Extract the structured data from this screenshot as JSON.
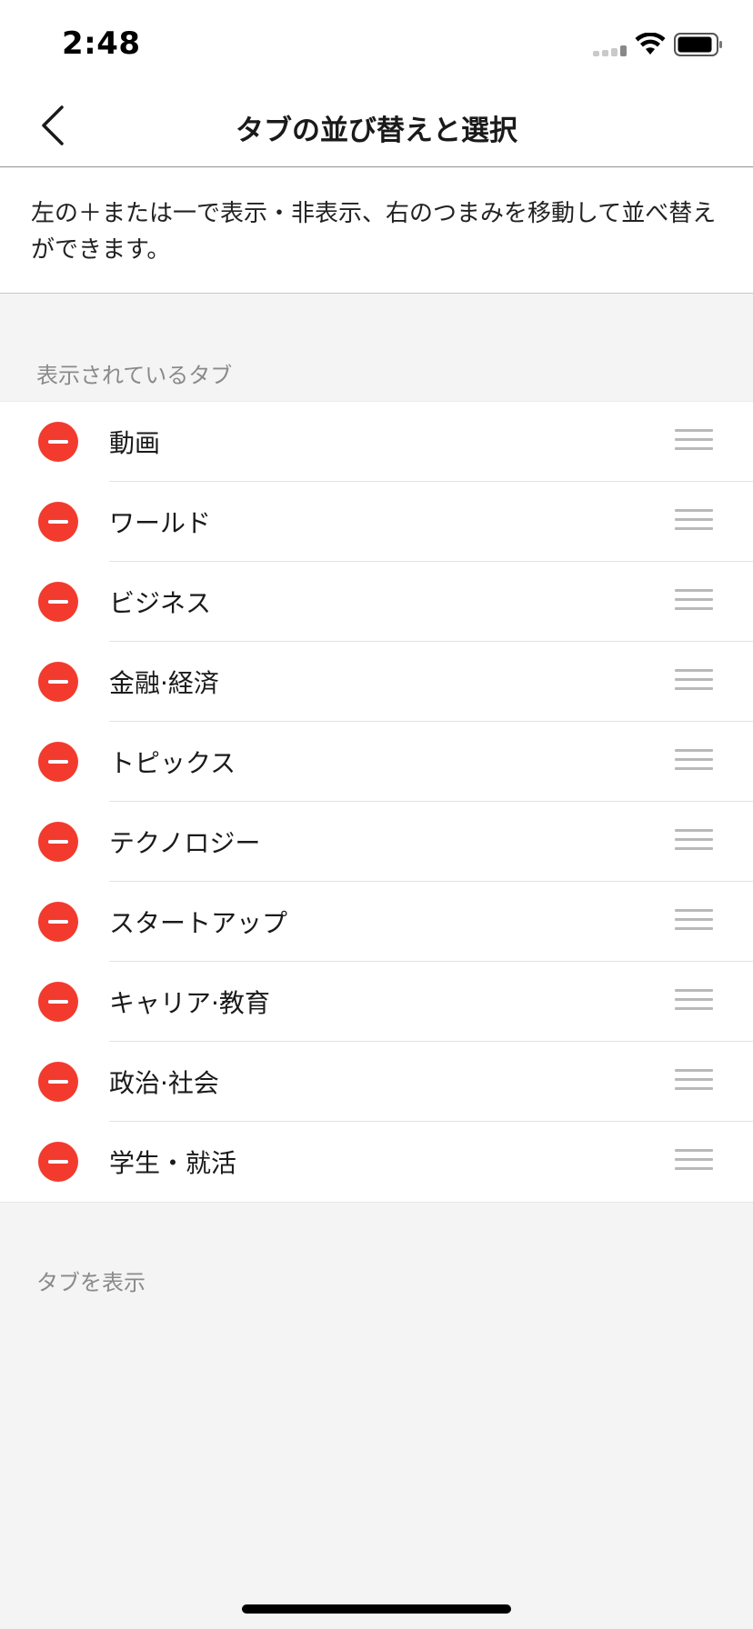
{
  "status_bar": {
    "time": "2:48"
  },
  "nav": {
    "title": "タブの並び替えと選択",
    "back_icon": "chevron-left-icon"
  },
  "description": "左の＋または一で表示・非表示、右のつまみを移動して並べ替えができます。",
  "sections": {
    "visible_header": "表示されているタブ",
    "hidden_header": "タブを表示"
  },
  "visible_tabs": [
    {
      "label": "動画"
    },
    {
      "label": "ワールド"
    },
    {
      "label": "ビジネス"
    },
    {
      "label": "金融·経済"
    },
    {
      "label": "トピックス"
    },
    {
      "label": "テクノロジー"
    },
    {
      "label": "スタートアップ"
    },
    {
      "label": "キャリア·教育"
    },
    {
      "label": "政治·社会"
    },
    {
      "label": "学生・就活"
    }
  ],
  "colors": {
    "remove_red": "#f33a2e",
    "handle_gray": "#b9b9b9",
    "section_text": "#8a8a8a",
    "background": "#f4f4f4"
  }
}
